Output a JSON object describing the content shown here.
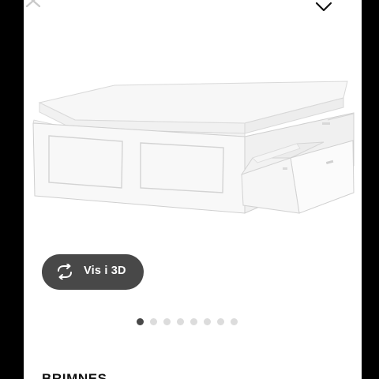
{
  "header": {
    "close_icon": "close-icon",
    "menu_icon": "chevron-down-icon"
  },
  "gallery": {
    "image_alt": "white bed frame with storage drawers",
    "view3d_label": "Vis i 3D",
    "view3d_icon": "rotate-icon",
    "page_count": 8,
    "active_page": 1
  },
  "product": {
    "name": "BRIMNES"
  },
  "colors": {
    "pill_bg": "#484848",
    "dot_active": "#484848",
    "dot_inactive": "#dcdcdc"
  }
}
